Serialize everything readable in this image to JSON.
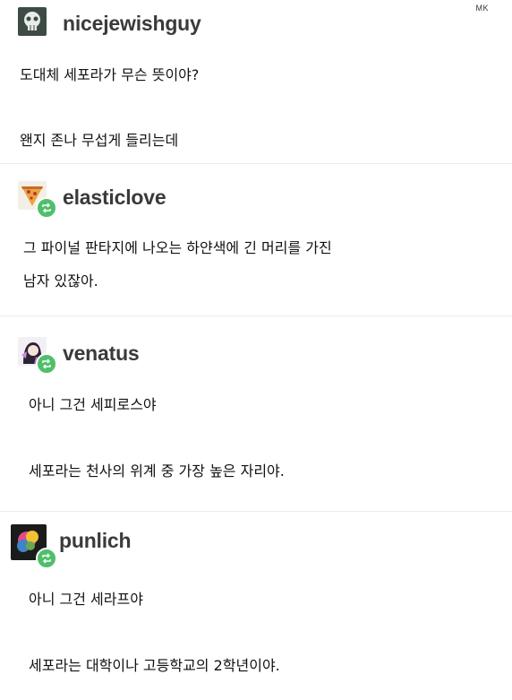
{
  "watermark": "MK",
  "posts": [
    {
      "username": "nicejewishguy",
      "avatar_icon": "skull-avatar-icon",
      "reblog": false,
      "lines": [
        "도대체 세포라가 무슨 뜻이야?",
        "왠지 존나 무섭게 들리는데"
      ]
    },
    {
      "username": "elasticlove",
      "avatar_icon": "pizza-avatar-icon",
      "reblog": true,
      "lines": [
        "그 파이널 판타지에 나오는 하얀색에 긴 머리를 가진",
        "남자 있잖아."
      ]
    },
    {
      "username": "venatus",
      "avatar_icon": "anime-girl-avatar-icon",
      "reblog": true,
      "lines": [
        "아니 그건 세피로스야",
        "세포라는 천사의 위계 중 가장 높은 자리야."
      ]
    },
    {
      "username": "punlich",
      "avatar_icon": "colorful-avatar-icon",
      "reblog": true,
      "lines": [
        "아니 그건 세라프야",
        "세포라는 대학이나 고등학교의 2학년이야."
      ]
    }
  ],
  "colors": {
    "reblog_badge": "#4fbf6b",
    "username": "#3a3a3a"
  }
}
